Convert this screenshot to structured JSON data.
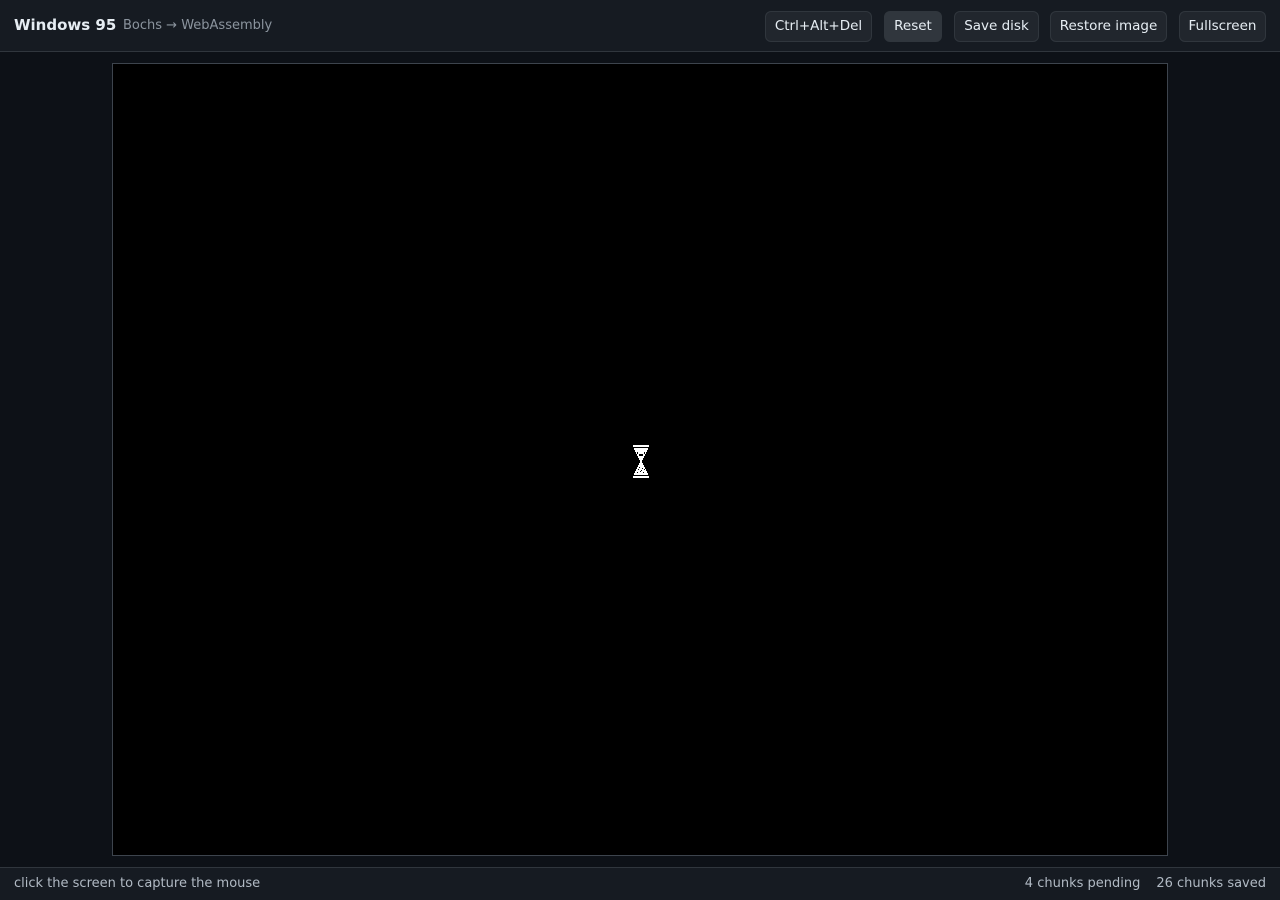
{
  "header": {
    "title": "Windows 95",
    "subtitle": "Bochs → WebAssembly"
  },
  "toolbar": {
    "ctrl_alt_del_label": "Ctrl+Alt+Del",
    "reset_label": "Reset",
    "save_disk_label": "Save disk",
    "restore_image_label": "Restore image",
    "fullscreen_label": "Fullscreen"
  },
  "emulator": {
    "cursor_icon": "hourglass-icon"
  },
  "status": {
    "hint": "click the screen to capture the mouse",
    "pending": "4 chunks pending",
    "saved": "26 chunks saved"
  },
  "colors": {
    "page_background": "#0d1117",
    "bar_background": "#161b22",
    "screen_background": "#000000"
  }
}
